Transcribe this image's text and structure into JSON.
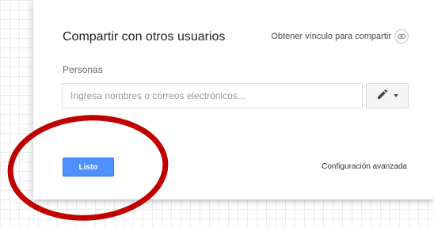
{
  "dialog": {
    "title": "Compartir con otros usuarios",
    "share_link_label": "Obtener vínculo para compartir",
    "share_link_icon": "link-icon",
    "people_label": "Personas",
    "people_input": {
      "placeholder": "Ingresa nombres o correos electrónicos...",
      "value": ""
    },
    "permission_button": {
      "icon": "pencil-icon",
      "dropdown_icon": "caret-down-icon"
    },
    "done_button_label": "Listo",
    "advanced_settings_label": "Configuración avanzada"
  },
  "colors": {
    "primary_button": "#4d90fe",
    "annotation_circle": "#c00000"
  }
}
